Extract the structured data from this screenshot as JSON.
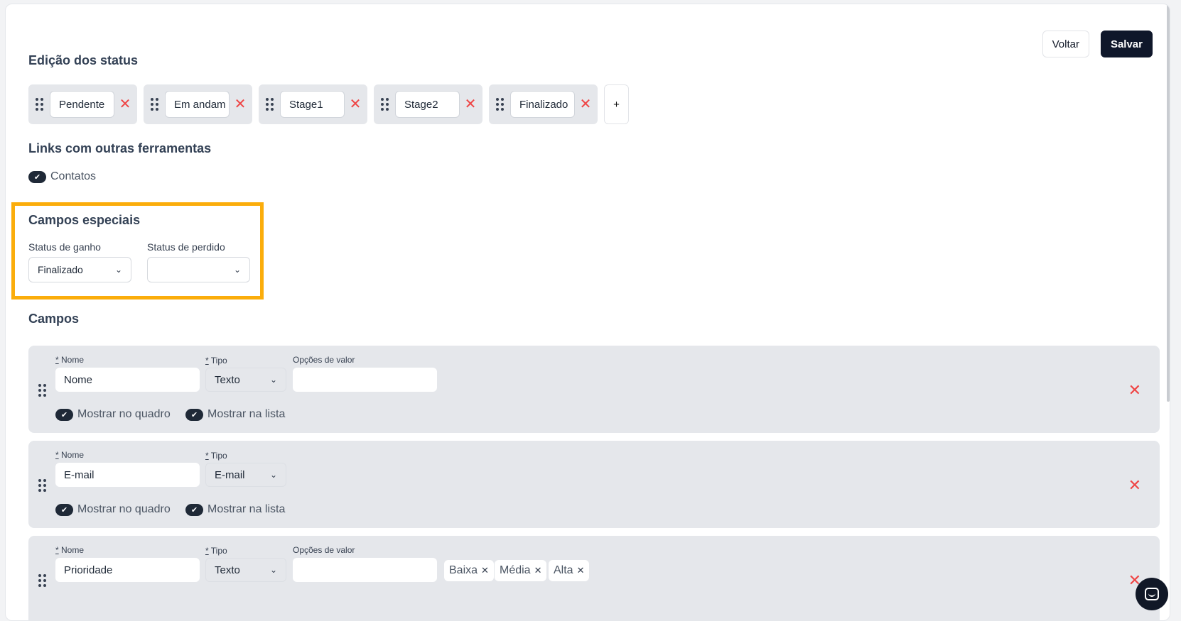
{
  "header": {
    "back_label": "Voltar",
    "save_label": "Salvar"
  },
  "status_section": {
    "title": "Edição dos status",
    "statuses": [
      "Pendente",
      "Em andam",
      "Stage1",
      "Stage2",
      "Finalizado"
    ],
    "add_label": "+"
  },
  "links_section": {
    "title": "Links com outras ferramentas",
    "contacts_label": "Contatos",
    "contacts_checked": true
  },
  "special_fields": {
    "title": "Campos especiais",
    "won_label": "Status de ganho",
    "won_value": "Finalizado",
    "lost_label": "Status de perdido",
    "lost_value": ""
  },
  "fields_section": {
    "title": "Campos",
    "name_label": "Nome",
    "type_label": "Tipo",
    "options_label": "Opções de valor",
    "required_mark": "*",
    "show_board_label": "Mostrar no quadro",
    "show_list_label": "Mostrar na lista",
    "fields": [
      {
        "name": "Nome",
        "type": "Texto",
        "has_options": true,
        "tags": []
      },
      {
        "name": "E-mail",
        "type": "E-mail",
        "has_options": false,
        "tags": []
      },
      {
        "name": "Prioridade",
        "type": "Texto",
        "has_options": true,
        "tags": [
          "Baixa",
          "Média",
          "Alta"
        ]
      }
    ]
  },
  "icons": {
    "remove": "close-icon",
    "drag": "drag-handle-icon",
    "dropdown": "chevron-down-icon",
    "check": "check-icon",
    "chat": "chat-icon"
  },
  "colors": {
    "primary": "#0f172a",
    "danger": "#ef4444",
    "highlight": "#fbad0b",
    "card_bg": "#e5e7eb"
  }
}
